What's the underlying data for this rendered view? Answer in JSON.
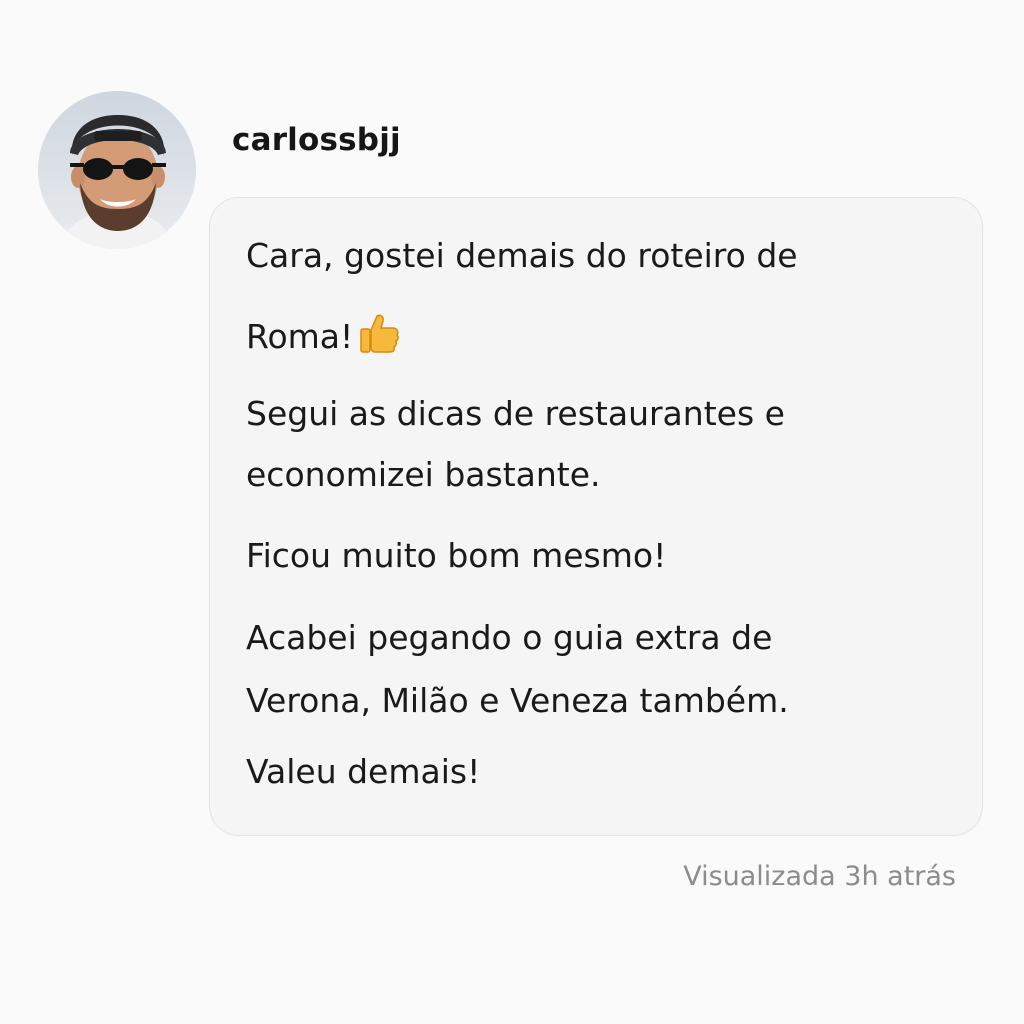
{
  "sender": {
    "username": "carlossbjj",
    "avatar_icon": "profile-photo-man-cap-sunglasses"
  },
  "message": {
    "lines": [
      "Cara, gostei demais do roteiro de",
      "Roma!",
      "Segui as dicas de restaurantes e",
      "economizei bastante.",
      "Ficou muito bom mesmo!",
      "Acabei pegando o guia extra de",
      "Verona, Milão e Veneza também.",
      "Valeu demais!"
    ],
    "emoji_icon": "thumbs-up-icon"
  },
  "status": {
    "seen_text": "Visualizada 3h atrás"
  },
  "colors": {
    "background": "#fbfafb",
    "bubble": "#f5f5f5",
    "status_text": "#8c8c8c"
  }
}
